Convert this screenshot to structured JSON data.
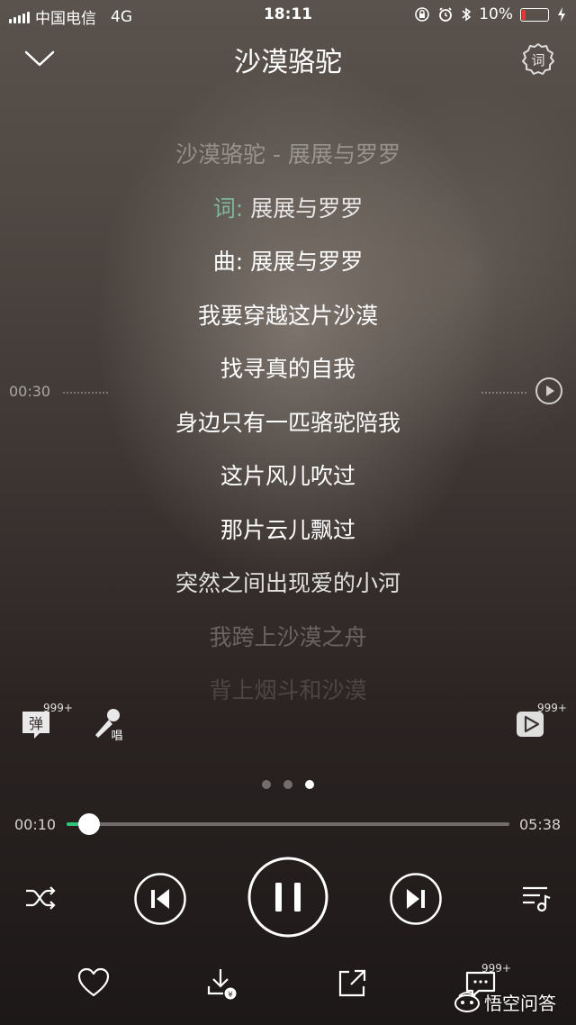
{
  "status_bar": {
    "carrier": "中国电信",
    "network": "4G",
    "time": "18:11",
    "battery": "10%"
  },
  "header": {
    "title": "沙漠骆驼",
    "settings_icon_label": "词"
  },
  "lyrics": {
    "song_line": "沙漠骆驼 - 展展与罗罗",
    "lyricist_label": "词:",
    "lyricist": "展展与罗罗",
    "composer_label": "曲:",
    "composer": "展展与罗罗",
    "lines": [
      "我要穿越这片沙漠",
      "找寻真的自我",
      "身边只有一匹骆驼陪我",
      "这片风儿吹过",
      "那片云儿飘过",
      "突然之间出现爱的小河",
      "我跨上沙漠之舟",
      "背上烟斗和沙漠"
    ],
    "seek_time": "00:30"
  },
  "side_actions": {
    "danmu_label": "弹",
    "danmu_badge": "999+",
    "sing_label": "唱",
    "video_badge": "999+"
  },
  "pager": {
    "count": 3,
    "active": 2
  },
  "progress": {
    "current": "00:10",
    "total": "05:38",
    "fraction": 0.03
  },
  "comment_badge": "999+",
  "watermark": "悟空问答",
  "colors": {
    "accent": "#31c27c",
    "lyricist_label": "#7fb79a"
  },
  "icons": {
    "back": "chevron-down-icon",
    "settings": "gear-lyrics-icon",
    "shuffle": "shuffle-icon",
    "prev": "previous-icon",
    "pause": "pause-icon",
    "next": "next-icon",
    "playlist": "playlist-icon",
    "favorite": "heart-icon",
    "download": "download-icon",
    "share": "share-icon",
    "comment": "comment-icon"
  }
}
